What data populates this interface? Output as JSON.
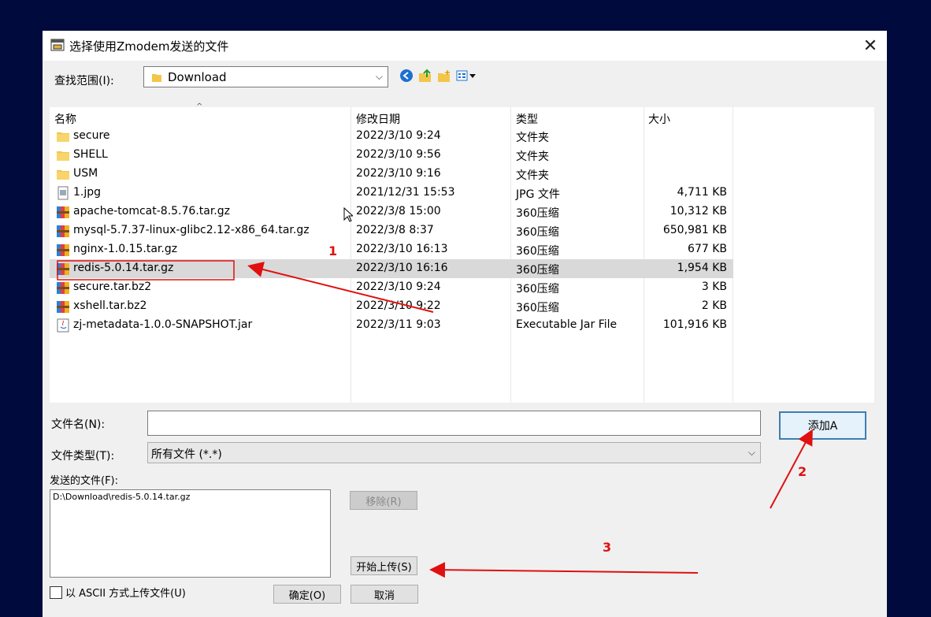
{
  "dialog": {
    "title": "选择使用Zmodem发送的文件",
    "close_glyph": "✕"
  },
  "lookin": {
    "label": "查找范围(I):",
    "value": "Download",
    "toolbar_icons": [
      "back-icon",
      "up-folder-icon",
      "new-folder-icon",
      "view-menu-icon"
    ]
  },
  "filelist": {
    "columns": [
      "名称",
      "修改日期",
      "类型",
      "大小"
    ],
    "sort_glyph": "^",
    "rows": [
      {
        "name": "secure",
        "date": "2022/3/10 9:24",
        "type": "文件夹",
        "size": "",
        "icon": "folder-icon"
      },
      {
        "name": "SHELL",
        "date": "2022/3/10 9:56",
        "type": "文件夹",
        "size": "",
        "icon": "folder-icon"
      },
      {
        "name": "USM",
        "date": "2022/3/10 9:16",
        "type": "文件夹",
        "size": "",
        "icon": "folder-icon"
      },
      {
        "name": "1.jpg",
        "date": "2021/12/31 15:53",
        "type": "JPG 文件",
        "size": "4,711 KB",
        "icon": "image-file-icon"
      },
      {
        "name": "apache-tomcat-8.5.76.tar.gz",
        "date": "2022/3/8 15:00",
        "type": "360压缩",
        "size": "10,312 KB",
        "icon": "archive-icon"
      },
      {
        "name": "mysql-5.7.37-linux-glibc2.12-x86_64.tar.gz",
        "date": "2022/3/8 8:37",
        "type": "360压缩",
        "size": "650,981 KB",
        "icon": "archive-icon"
      },
      {
        "name": "nginx-1.0.15.tar.gz",
        "date": "2022/3/10 16:13",
        "type": "360压缩",
        "size": "677 KB",
        "icon": "archive-icon"
      },
      {
        "name": "redis-5.0.14.tar.gz",
        "date": "2022/3/10 16:16",
        "type": "360压缩",
        "size": "1,954 KB",
        "icon": "archive-icon",
        "selected": true
      },
      {
        "name": "secure.tar.bz2",
        "date": "2022/3/10 9:24",
        "type": "360压缩",
        "size": "3 KB",
        "icon": "archive-icon"
      },
      {
        "name": "xshell.tar.bz2",
        "date": "2022/3/10 9:22",
        "type": "360压缩",
        "size": "2 KB",
        "icon": "archive-icon"
      },
      {
        "name": "zj-metadata-1.0.0-SNAPSHOT.jar",
        "date": "2022/3/11 9:03",
        "type": "Executable Jar File",
        "size": "101,916 KB",
        "icon": "java-jar-icon"
      }
    ]
  },
  "form": {
    "filename_label": "文件名(N):",
    "filename_value": "",
    "add_button": "添加A",
    "filetype_label": "文件类型(T):",
    "filetype_value": "所有文件 (*.*)",
    "sent_files_label": "发送的文件(F):",
    "sent_files": [
      "D:\\Download\\redis-5.0.14.tar.gz"
    ],
    "remove_button": "移除(R)",
    "start_upload_button": "开始上传(S)",
    "ascii_checkbox_label": "以 ASCII 方式上传文件(U)",
    "ascii_checked": false,
    "ok_button": "确定(O)",
    "cancel_button": "取消"
  },
  "annotations": {
    "color": "#e01010",
    "labels": [
      "1",
      "2",
      "3"
    ]
  }
}
